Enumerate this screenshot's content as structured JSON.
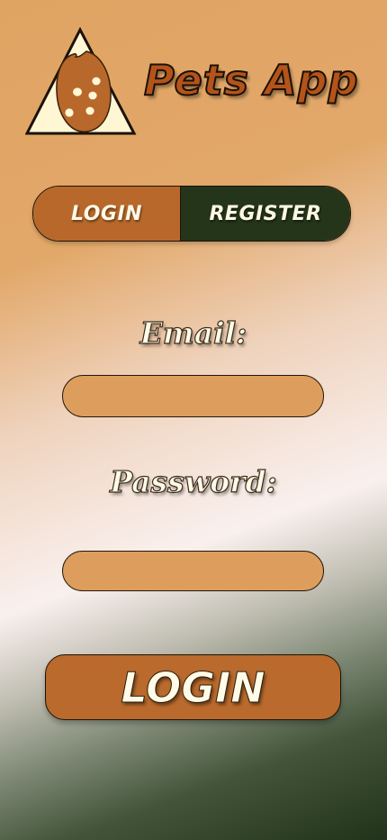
{
  "header": {
    "logo_icon": "pet-food-triangle-logo",
    "title": "Pets App"
  },
  "auth_tabs": {
    "login_label": "LOGIN",
    "register_label": "REGISTER",
    "selected": "LOGIN"
  },
  "form": {
    "email_label": "Email:",
    "email_value": "",
    "password_label": "Password:",
    "password_value": ""
  },
  "submit": {
    "label": "LOGIN"
  },
  "colors": {
    "accent_brown": "#b96a2c",
    "dark_green": "#253519",
    "input_fill": "#dd9e5d",
    "cream": "#fffbe6"
  }
}
